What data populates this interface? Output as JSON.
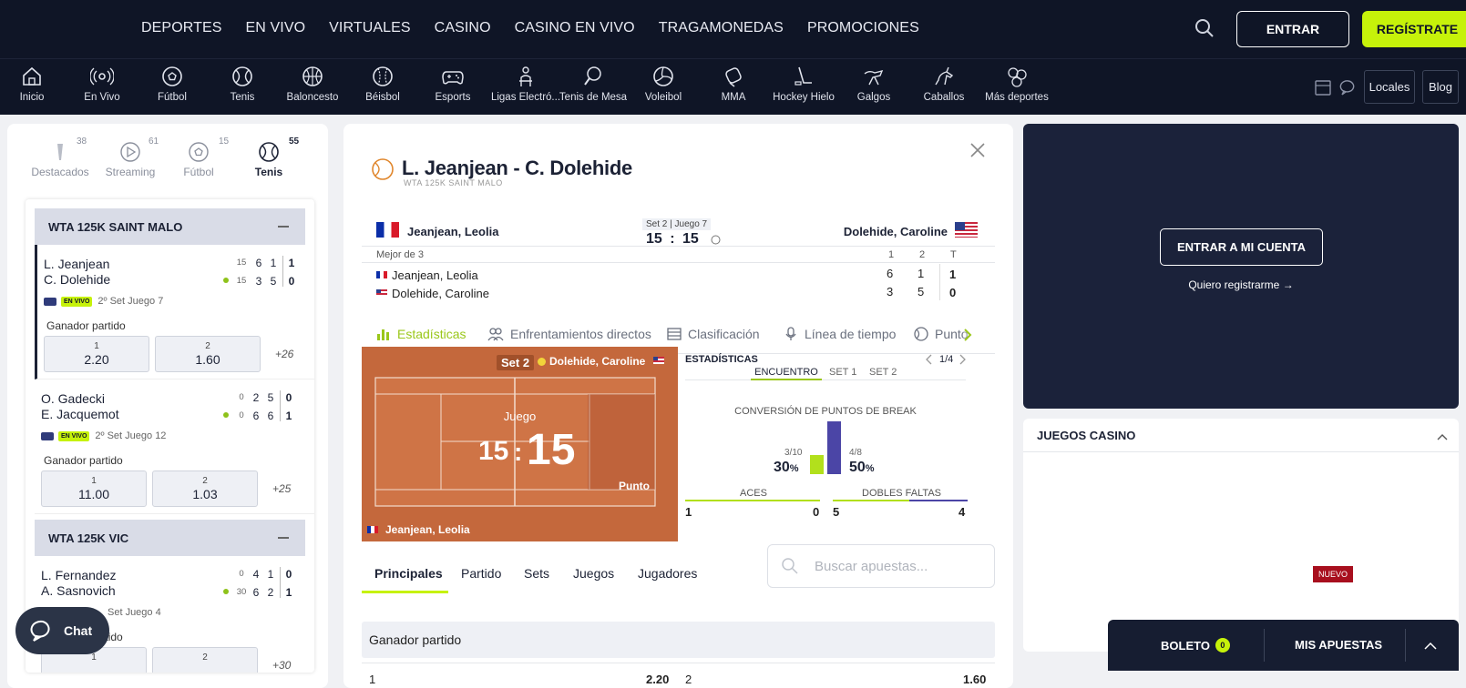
{
  "topnav": {
    "menu": [
      "DEPORTES",
      "EN VIVO",
      "VIRTUALES",
      "CASINO",
      "CASINO EN VIVO",
      "TRAGAMONEDAS",
      "PROMOCIONES"
    ],
    "login_label": "ENTRAR",
    "register_label": "REGÍSTRATE"
  },
  "sports": [
    {
      "label": "Inicio",
      "icon": "home-icon"
    },
    {
      "label": "En Vivo",
      "icon": "live-icon"
    },
    {
      "label": "Fútbol",
      "icon": "soccer-icon"
    },
    {
      "label": "Tenis",
      "icon": "tennis-icon"
    },
    {
      "label": "Baloncesto",
      "icon": "basketball-icon"
    },
    {
      "label": "Béisbol",
      "icon": "baseball-icon"
    },
    {
      "label": "Esports",
      "icon": "gamepad-icon"
    },
    {
      "label": "Ligas Electró...",
      "icon": "e-league-icon"
    },
    {
      "label": "Tenis de Mesa",
      "icon": "table-tennis-icon"
    },
    {
      "label": "Voleibol",
      "icon": "volleyball-icon"
    },
    {
      "label": "MMA",
      "icon": "mma-glove-icon"
    },
    {
      "label": "Hockey Hielo",
      "icon": "hockey-icon"
    },
    {
      "label": "Galgos",
      "icon": "greyhound-icon"
    },
    {
      "label": "Caballos",
      "icon": "horse-icon"
    },
    {
      "label": "Más deportes",
      "icon": "more-sports-icon"
    }
  ],
  "utility": {
    "locales": "Locales",
    "blog": "Blog"
  },
  "left": {
    "tabs": [
      {
        "label": "Destacados",
        "count": "38"
      },
      {
        "label": "Streaming",
        "count": "61"
      },
      {
        "label": "Fútbol",
        "count": "15"
      },
      {
        "label": "Tenis",
        "count": "55"
      }
    ],
    "leagues": [
      {
        "name": "WTA 125K SAINT MALO",
        "matches": [
          {
            "p1": "L. Jeanjean",
            "p2": "C. Dolehide",
            "s1": [
              "15",
              "6",
              "1",
              "1"
            ],
            "s2": [
              "15",
              "3",
              "5",
              "0"
            ],
            "live": "EN VIVO",
            "status": "2º Set Juego 7",
            "market": "Ganador partido",
            "o1_label": "1",
            "o1": "2.20",
            "o2_label": "2",
            "o2": "1.60",
            "more": "+26"
          },
          {
            "p1": "O. Gadecki",
            "p2": "E. Jacquemot",
            "s1": [
              "0",
              "2",
              "5",
              "0"
            ],
            "s2": [
              "0",
              "6",
              "6",
              "1"
            ],
            "live": "EN VIVO",
            "status": "2º Set Juego 12",
            "market": "Ganador partido",
            "o1_label": "1",
            "o1": "11.00",
            "o2_label": "2",
            "o2": "1.03",
            "more": "+25"
          }
        ]
      },
      {
        "name": "WTA 125K VIC",
        "matches": [
          {
            "p1": "L. Fernandez",
            "p2": "A. Sasnovich",
            "s1": [
              "0",
              "4",
              "1",
              "0"
            ],
            "s2": [
              "30",
              "6",
              "2",
              "1"
            ],
            "status": "Set Juego 4",
            "market": "Ganador partido",
            "o1_label": "1",
            "o2_label": "2",
            "more": "+30"
          }
        ]
      }
    ]
  },
  "chat_label": "Chat",
  "event": {
    "title": "L. Jeanjean - C. Dolehide",
    "league": "WTA 125K SAINT MALO",
    "home": "Jeanjean, Leolia",
    "away": "Dolehide, Caroline",
    "set_info": "Set 2 | Juego 7",
    "score_home": "15",
    "score_sep": ":",
    "score_away": "15",
    "best_of": "Mejor de 3",
    "col_headers": [
      "1",
      "2",
      "T"
    ],
    "home_sets": [
      "6",
      "1",
      "1"
    ],
    "away_sets": [
      "3",
      "5",
      "0"
    ]
  },
  "stat_tabs": [
    "Estadísticas",
    "Enfrentamientos directos",
    "Clasificación",
    "Línea de tiempo",
    "Punto"
  ],
  "court": {
    "set": "Set 2",
    "server": "Dolehide, Caroline",
    "juego": "Juego",
    "home_pts": "15",
    "sep": ":",
    "away_pts": "15",
    "punto": "Punto",
    "bottom_player": "Jeanjean, Leolia"
  },
  "stats": {
    "title": "ESTADÍSTICAS",
    "page": "1/4",
    "tabs": [
      "ENCUENTRO",
      "SET 1",
      "SET 2"
    ],
    "break_title": "CONVERSIÓN DE PUNTOS DE BREAK",
    "home_break_frac": "3/10",
    "home_break_pct": "30",
    "away_break_frac": "4/8",
    "away_break_pct": "50",
    "pct_sign": "%",
    "home_break_value": 0.3,
    "away_break_value": 0.5,
    "aces_label": "ACES",
    "aces_home": "1",
    "aces_away": "0",
    "df_label": "DOBLES FALTAS",
    "df_home": "5",
    "df_away": "4"
  },
  "market_tabs": [
    "Principales",
    "Partido",
    "Sets",
    "Juegos",
    "Jugadores"
  ],
  "search_placeholder": "Buscar apuestas...",
  "market_title": "Ganador partido",
  "market_row": {
    "left_label": "1",
    "left_odd": "2.20",
    "right_label": "2",
    "right_odd": "1.60"
  },
  "right": {
    "account_label": "ENTRAR A MI CUENTA",
    "register_link": "Quiero registrarme",
    "casino_title": "JUEGOS CASINO",
    "nuevo": "NUEVO"
  },
  "betslip": {
    "label": "BOLETO",
    "count": "0",
    "bets": "MIS APUESTAS"
  },
  "colors": {
    "navy": "#0f1526",
    "lime": "#c6f20a",
    "clay": "#c4683c",
    "purple": "#4b45a6"
  }
}
